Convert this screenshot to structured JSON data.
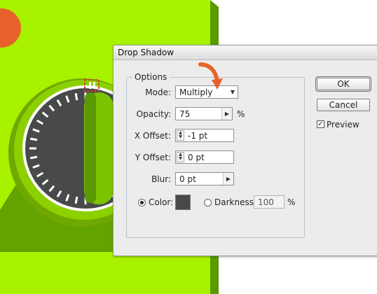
{
  "dialog": {
    "title": "Drop Shadow",
    "options_label": "Options",
    "mode": {
      "label": "Mode:",
      "value": "Multiply"
    },
    "opacity": {
      "label": "Opacity:",
      "value": "75",
      "unit": "%"
    },
    "x_offset": {
      "label": "X Offset:",
      "value": "-1 pt"
    },
    "y_offset": {
      "label": "Y Offset:",
      "value": "0 pt"
    },
    "blur": {
      "label": "Blur:",
      "value": "0 pt"
    },
    "color": {
      "label": "Color:",
      "selected": true,
      "swatch": "#48494b"
    },
    "darkness": {
      "label": "Darkness:",
      "value": "100",
      "unit": "%",
      "selected": false
    },
    "ok_label": "OK",
    "cancel_label": "Cancel",
    "preview": {
      "label": "Preview",
      "checked": true
    }
  },
  "colors": {
    "background_green": "#a8f200",
    "artwork_dark_green": "#5a9a00",
    "artwork_mid_green": "#7cc400",
    "dial_face": "#48494b",
    "accent_orange": "#e8632c"
  }
}
